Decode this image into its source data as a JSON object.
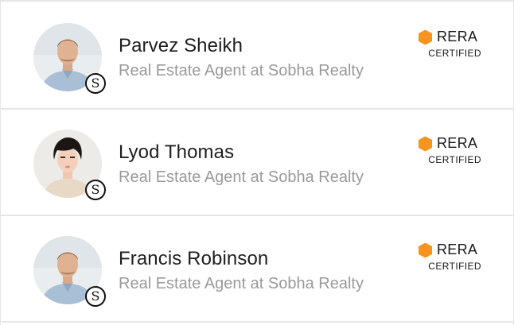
{
  "agents": [
    {
      "name": "Parvez Sheikh",
      "subtitle": "Real Estate Agent at Sobha Realty",
      "badge_title": "RERA",
      "badge_subtitle": "CERTIFIED",
      "brand_mark": "S"
    },
    {
      "name": "Lyod Thomas",
      "subtitle": "Real Estate Agent at Sobha Realty",
      "badge_title": "RERA",
      "badge_subtitle": "CERTIFIED",
      "brand_mark": "S"
    },
    {
      "name": "Francis Robinson",
      "subtitle": "Real Estate Agent at Sobha Realty",
      "badge_title": "RERA",
      "badge_subtitle": "CERTIFIED",
      "brand_mark": "S"
    }
  ],
  "colors": {
    "badge_orange": "#f7941d",
    "divider": "#e6e6e6",
    "name_text": "#1e1e1e",
    "subtitle_text": "#9a9a9a"
  },
  "icons": {
    "certified": "hexagon-icon",
    "brand": "sobha-logo-icon"
  }
}
